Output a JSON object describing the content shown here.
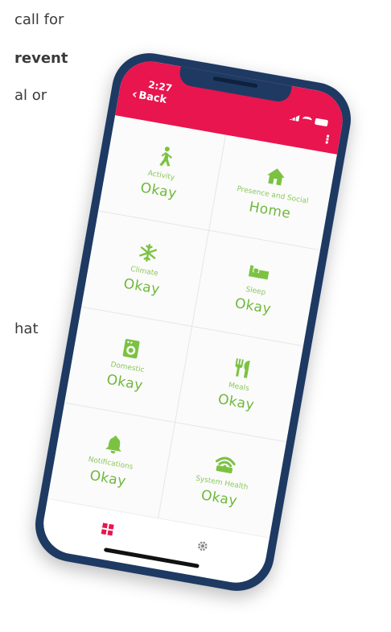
{
  "background_text": {
    "line1": "call for",
    "line2": "revent",
    "line3": "al or",
    "line4": "hat"
  },
  "status_bar": {
    "time": "2:27"
  },
  "header": {
    "back_label": "Back",
    "color": "#e8154e"
  },
  "tiles": [
    {
      "label": "Activity",
      "value": "Okay",
      "icon": "walking-person-icon"
    },
    {
      "label": "Presence and Social",
      "value": "Home",
      "icon": "house-icon"
    },
    {
      "label": "Climate",
      "value": "Okay",
      "icon": "snowflake-icon"
    },
    {
      "label": "Sleep",
      "value": "Okay",
      "icon": "bed-icon"
    },
    {
      "label": "Domestic",
      "value": "Okay",
      "icon": "washing-machine-icon"
    },
    {
      "label": "Meals",
      "value": "Okay",
      "icon": "fork-knife-icon"
    },
    {
      "label": "Notifications",
      "value": "Okay",
      "icon": "bell-icon"
    },
    {
      "label": "System Health",
      "value": "Okay",
      "icon": "router-wifi-icon"
    }
  ],
  "tabbar": {
    "dashboard_icon": "dashboard-grid-icon",
    "settings_icon": "gear-icon",
    "active_color": "#e8154e"
  },
  "colors": {
    "accent_green": "#7cc242",
    "phone_frame": "#1e3a63"
  }
}
